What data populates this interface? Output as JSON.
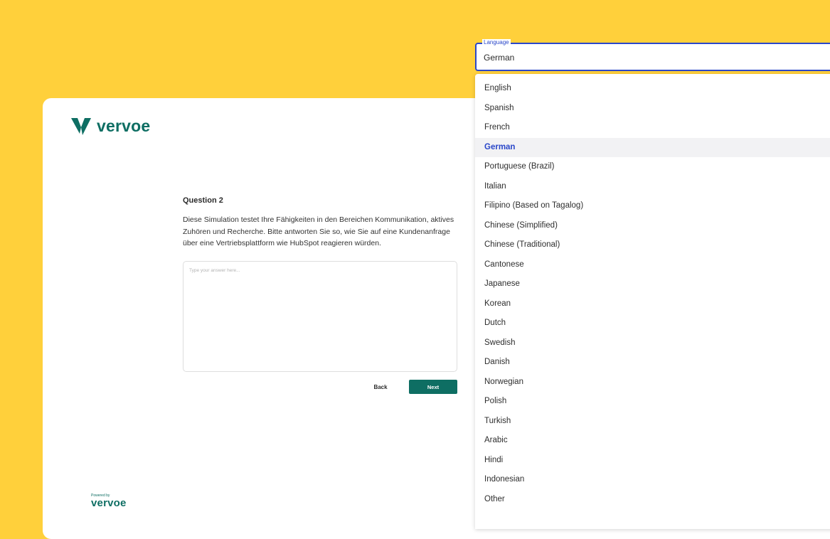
{
  "brand": {
    "logo_text": "vervoe",
    "powered_label": "Powered by",
    "powered_logo": "vervoe",
    "color": "#0E6E63",
    "background": "#FFD03B"
  },
  "question": {
    "title": "Question 2",
    "body": "Diese Simulation testet Ihre Fähigkeiten in den Bereichen Kommunikation, aktives Zuhören und Recherche. Bitte antworten Sie so, wie Sie auf eine Kundenanfrage über eine Vertriebsplattform wie HubSpot reagieren würden.",
    "answer_placeholder": "Type your answer here..."
  },
  "nav": {
    "back_label": "Back",
    "next_label": "Next"
  },
  "language": {
    "label": "Language",
    "value": "German",
    "accent": "#2a47c9",
    "options": [
      {
        "label": "English"
      },
      {
        "label": "Spanish"
      },
      {
        "label": "French"
      },
      {
        "label": "German",
        "selected": true
      },
      {
        "label": "Portuguese (Brazil)"
      },
      {
        "label": "Italian"
      },
      {
        "label": "Filipino (Based on Tagalog)"
      },
      {
        "label": "Chinese (Simplified)"
      },
      {
        "label": "Chinese (Traditional)"
      },
      {
        "label": "Cantonese"
      },
      {
        "label": "Japanese"
      },
      {
        "label": "Korean"
      },
      {
        "label": "Dutch"
      },
      {
        "label": "Swedish"
      },
      {
        "label": "Danish"
      },
      {
        "label": "Norwegian"
      },
      {
        "label": "Polish"
      },
      {
        "label": "Turkish"
      },
      {
        "label": "Arabic"
      },
      {
        "label": "Hindi"
      },
      {
        "label": "Indonesian"
      },
      {
        "label": "Other"
      }
    ]
  }
}
